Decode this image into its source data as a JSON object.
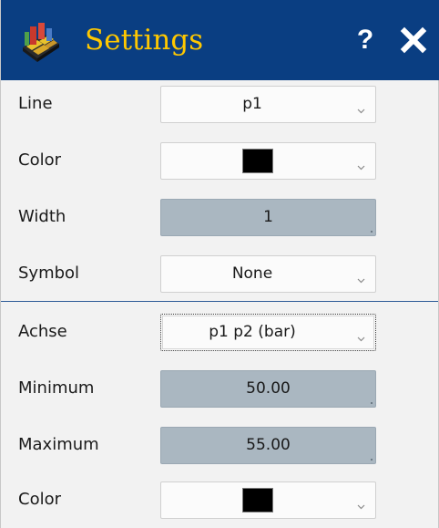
{
  "window": {
    "title": "Settings",
    "help_label": "?",
    "icon": "chart-grid-icon",
    "close_icon": "close-icon"
  },
  "colors": {
    "titlebar": "#0a3e82",
    "title_text": "#ffc800",
    "separator": "#2d5b97",
    "readonly_field": "#aab7c1"
  },
  "line_section": {
    "line": {
      "label": "Line",
      "value": "p1"
    },
    "color": {
      "label": "Color",
      "swatch_color": "#000000"
    },
    "width": {
      "label": "Width",
      "value": "1"
    },
    "symbol": {
      "label": "Symbol",
      "value": "None"
    }
  },
  "axis_section": {
    "axis": {
      "label": "Achse",
      "value": "p1 p2 (bar)"
    },
    "minimum": {
      "label": "Minimum",
      "value": "50.00"
    },
    "maximum": {
      "label": "Maximum",
      "value": "55.00"
    },
    "color": {
      "label": "Color",
      "swatch_color": "#000000"
    }
  }
}
